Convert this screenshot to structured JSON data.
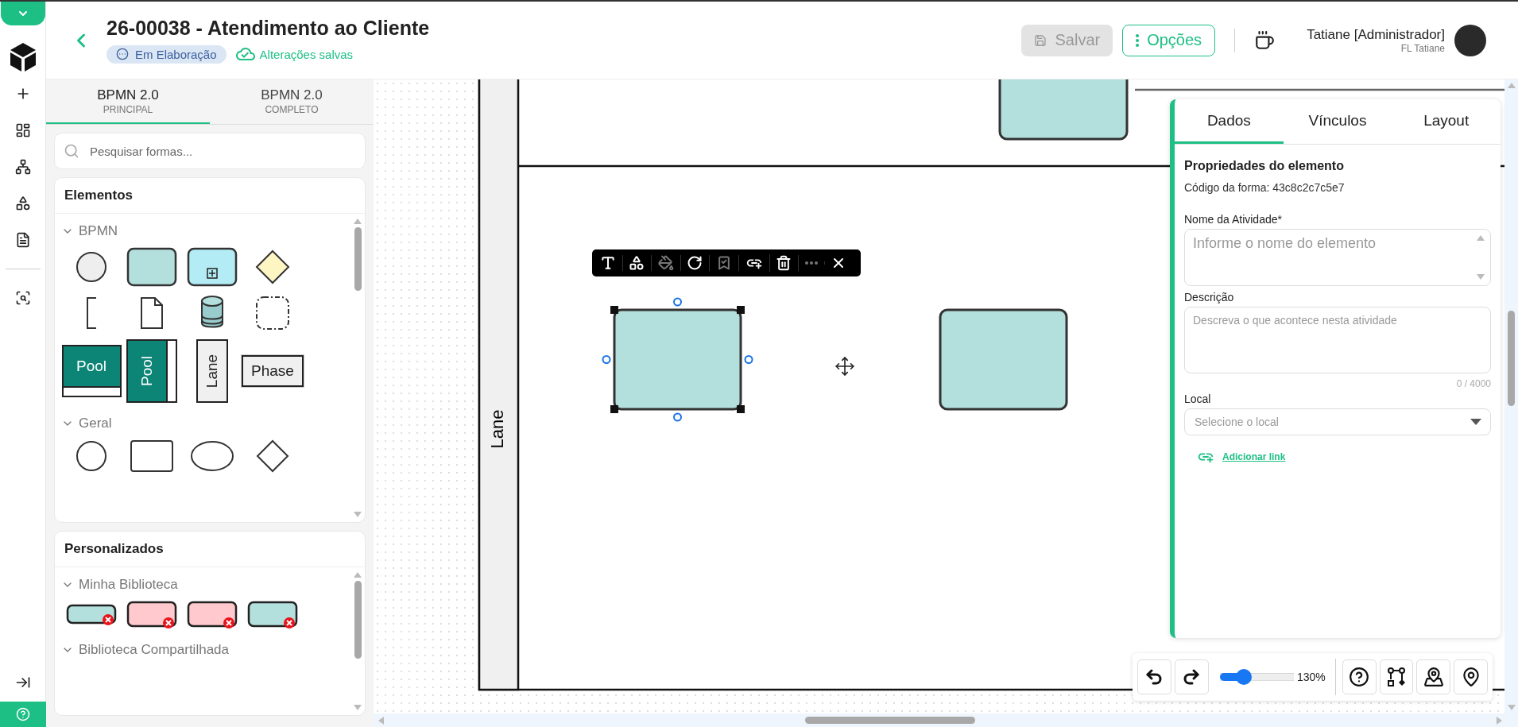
{
  "header": {
    "title": "26-00038 - Atendimento ao Cliente",
    "status": "Em Elaboração",
    "save_state": "Alterações salvas",
    "buttons": [
      {
        "kind": "save",
        "label": "Salvar",
        "disabled": true
      },
      {
        "kind": "options",
        "label": "Opções",
        "disabled": false
      }
    ],
    "user": {
      "name": "Tatiane [Administrador]",
      "org": "FL Tatiane"
    }
  },
  "library_tabs": [
    {
      "label": "BPMN 2.0",
      "sublabel": "PRINCIPAL",
      "selected": true
    },
    {
      "label": "BPMN 2.0",
      "sublabel": "COMPLETO",
      "selected": false
    }
  ],
  "search": {
    "placeholder": "Pesquisar formas..."
  },
  "shape_panels": [
    {
      "title": "Elementos",
      "groups": [
        {
          "name": "BPMN",
          "expanded": true,
          "shapes": [
            {
              "kind": "event"
            },
            {
              "kind": "task"
            },
            {
              "kind": "subprocess"
            },
            {
              "kind": "gateway"
            },
            {
              "kind": "annotation"
            },
            {
              "kind": "document"
            },
            {
              "kind": "database"
            },
            {
              "kind": "group"
            },
            {
              "kind": "pool",
              "label": "Pool"
            },
            {
              "kind": "vertical-pool",
              "label": "Pool"
            },
            {
              "kind": "lane",
              "label": "Lane"
            },
            {
              "kind": "phase",
              "label": "Phase"
            }
          ]
        },
        {
          "name": "Geral",
          "expanded": true,
          "shapes": [
            {
              "kind": "circle"
            },
            {
              "kind": "rectangle"
            },
            {
              "kind": "ellipse"
            },
            {
              "kind": "diamond"
            }
          ]
        }
      ]
    },
    {
      "title": "Personalizados",
      "groups": [
        {
          "name": "Minha Biblioteca",
          "expanded": true,
          "shapes": [
            {
              "kind": "slim",
              "color": "#b3e0dd"
            },
            {
              "kind": "card",
              "color": "#ffc9cd"
            },
            {
              "kind": "card",
              "color": "#ffc9cd"
            },
            {
              "kind": "card",
              "color": "#b3e0dd"
            }
          ]
        },
        {
          "name": "Biblioteca Compartilhada",
          "expanded": true
        }
      ]
    }
  ],
  "canvas": {
    "lane_label": "Lane",
    "tools": [
      {
        "kind": "text",
        "disabled": false
      },
      {
        "kind": "shapes",
        "disabled": false
      },
      {
        "kind": "fill",
        "disabled": true
      },
      {
        "kind": "rotate",
        "disabled": false
      },
      {
        "kind": "bookmark",
        "disabled": true
      },
      {
        "kind": "link",
        "disabled": false
      },
      {
        "kind": "delete",
        "disabled": false
      },
      {
        "kind": "more",
        "disabled": true
      },
      {
        "kind": "close",
        "disabled": false
      }
    ]
  },
  "properties": {
    "tabs": [
      {
        "label": "Dados",
        "selected": true
      },
      {
        "label": "Vínculos",
        "selected": false
      },
      {
        "label": "Layout",
        "selected": false
      }
    ],
    "heading": "Propriedades do elemento",
    "code": "Código da forma: 43c8c2c7c5e7",
    "fields": [
      {
        "kind": "spin",
        "label": "Nome da Atividade*",
        "placeholder": "Informe o nome do elemento"
      },
      {
        "kind": "textarea",
        "label": "Descrição",
        "placeholder": "Descreva o que acontece nesta atividade",
        "counter": "0 / 4000"
      },
      {
        "kind": "select",
        "label": "Local",
        "placeholder": "Selecione o local"
      }
    ],
    "link": "Adicionar link"
  },
  "zoom": {
    "level": 0.33,
    "reading": "130%"
  }
}
